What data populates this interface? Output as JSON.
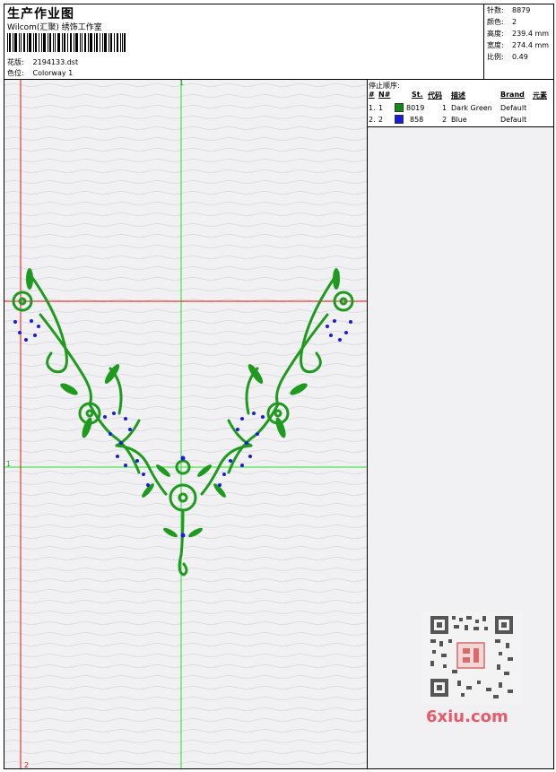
{
  "header": {
    "title": "生产作业图",
    "studio": "Wilcom(汇聚) 绣饰工作室",
    "design_label": "花版:",
    "design_value": "2194133.dst",
    "colorway_label": "色位:",
    "colorway_value": "Colorway 1"
  },
  "info": {
    "stitches_label": "针数:",
    "stitches_value": "8879",
    "colors_label": "颜色:",
    "colors_value": "2",
    "height_label": "高度:",
    "height_value": "239.4 mm",
    "width_label": "宽度:",
    "width_value": "274.4 mm",
    "scale_label": "比例:",
    "scale_value": "0.49"
  },
  "canvas": {
    "guide_top_label": "1",
    "guide_left_label": "1",
    "guide_bottom_label": "2"
  },
  "stop_sequence": {
    "title": "停止顺序:",
    "columns": [
      "#",
      "N#",
      "St.",
      "代码",
      "描述",
      "Brand",
      "元素"
    ],
    "rows": [
      {
        "idx": "1.",
        "n": "1",
        "st": "8019",
        "code": "1",
        "desc": "Dark Green",
        "brand": "Default",
        "color": "#138a13"
      },
      {
        "idx": "2.",
        "n": "2",
        "st": "858",
        "code": "2",
        "desc": "Blue",
        "brand": "Default",
        "color": "#1a1ae6"
      }
    ]
  },
  "watermark": {
    "site": "6xiu.com"
  },
  "colors": {
    "thread_green": "#1e9a1e",
    "thread_blue": "#1a1ae6",
    "guide_green": "#22dd22",
    "guide_red": "#dd1111"
  }
}
